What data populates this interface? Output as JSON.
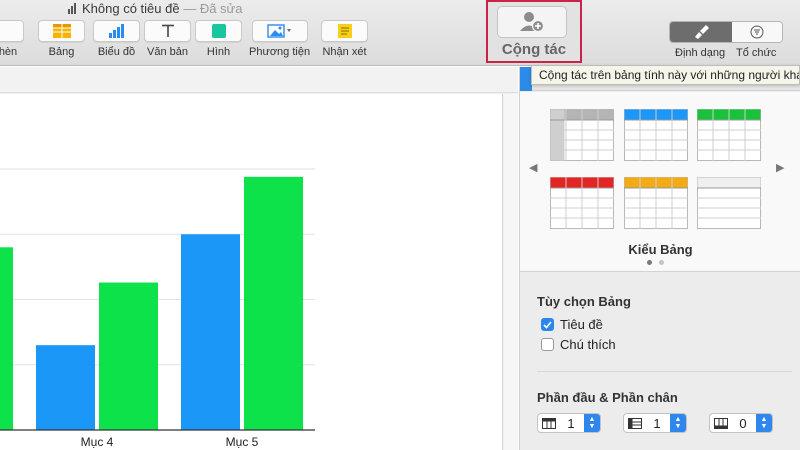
{
  "window": {
    "title": "Không có tiêu đề",
    "separator": "—",
    "status": "Đã sửa"
  },
  "toolbar": {
    "items": [
      {
        "label": "hèn",
        "icon": "insert-icon"
      },
      {
        "label": "Bảng",
        "icon": "table-icon"
      },
      {
        "label": "Biểu đồ",
        "icon": "chart-icon"
      },
      {
        "label": "Văn bản",
        "icon": "text-icon"
      },
      {
        "label": "Hình",
        "icon": "shape-icon"
      },
      {
        "label": "Phương tiện",
        "icon": "media-icon"
      },
      {
        "label": "Nhận xét",
        "icon": "comment-icon"
      }
    ],
    "collaborate": {
      "label": "Cộng tác",
      "icon": "add-person-icon"
    },
    "format": {
      "label": "Định dạng",
      "icon": "paintbrush-icon"
    },
    "organize": {
      "label": "Tổ chức",
      "icon": "filter-icon"
    }
  },
  "tooltip": {
    "text": "Cộng tác trên bảng tính này với những người khác"
  },
  "colors": {
    "series_blue": "#1a97f7",
    "series_green": "#0de24b",
    "highlight_red": "#c9234a",
    "accent_blue": "#2d86f0",
    "table_style_colors": [
      "#b4b4b4",
      "#1a97f7",
      "#19c23a",
      "#e32525",
      "#f3aa14",
      "#d9d9d9"
    ]
  },
  "chart_data": {
    "type": "bar",
    "categories": [
      "",
      "Mục 4",
      "Mục 5"
    ],
    "series": [
      {
        "values": [
          null,
          65,
          150
        ]
      },
      {
        "values": [
          140,
          113,
          194
        ]
      }
    ],
    "ylim": [
      0,
      200
    ],
    "grid": true
  },
  "sidebar": {
    "table_styles": {
      "title": "Kiểu Bảng",
      "styles": [
        {
          "name": "gray-style",
          "header": "#b4b4b4"
        },
        {
          "name": "blue-style",
          "header": "#1a97f7"
        },
        {
          "name": "green-style",
          "header": "#19c23a"
        },
        {
          "name": "red-style",
          "header": "#e32525"
        },
        {
          "name": "orange-style",
          "header": "#f3aa14"
        },
        {
          "name": "plain-style",
          "header": "#d9d9d9"
        }
      ],
      "page_count": 2,
      "current_page": 1
    },
    "table_options": {
      "title": "Tùy chọn Bảng",
      "title_checkbox": {
        "label": "Tiêu đề",
        "checked": true
      },
      "caption_checkbox": {
        "label": "Chú thích",
        "checked": false
      }
    },
    "headers_footers": {
      "title": "Phần đầu & Phần chân",
      "header_rows": "1",
      "header_columns": "1",
      "footer_rows": "0"
    }
  }
}
